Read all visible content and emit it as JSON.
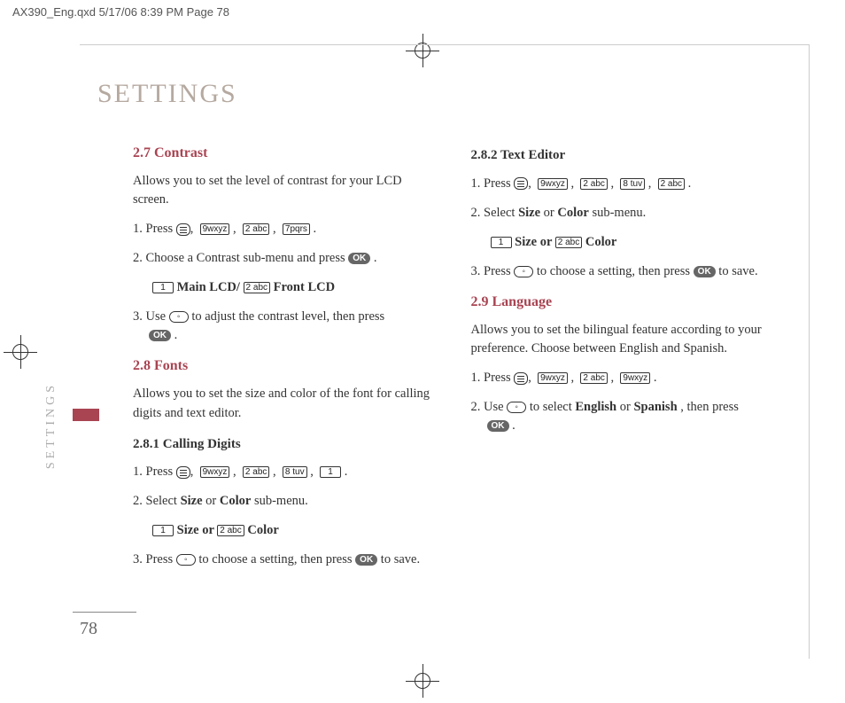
{
  "meta_header": "AX390_Eng.qxd  5/17/06  8:39 PM  Page 78",
  "page_title": "SETTINGS",
  "side_tab": "SETTINGS",
  "page_number": "78",
  "left": {
    "s27_head": "2.7 Contrast",
    "s27_intro": "Allows you to set the level of contrast for your LCD screen.",
    "s27_step1_a": "1. Press ",
    "s27_step1_b": " .",
    "s27_step2_a": "2. Choose a Contrast sub-menu and press ",
    "s27_step2_b": " .",
    "s27_sub_a": " Main LCD/ ",
    "s27_sub_b": " Front LCD",
    "s27_step3_a": "3. Use ",
    "s27_step3_b": " to adjust the contrast level, then press ",
    "s27_step3_c": " .",
    "s28_head": "2.8 Fonts",
    "s28_intro": "Allows you to set the size and color of the font for calling digits and text editor.",
    "s281_head": "2.8.1 Calling Digits",
    "s281_step1_a": "1. Press ",
    "s281_step1_b": " .",
    "s281_step2_a": "2. Select ",
    "s281_step2_size": "Size",
    "s281_step2_or": " or ",
    "s281_step2_color": "Color",
    "s281_step2_b": " sub-menu.",
    "s281_sub_a": " Size or ",
    "s281_sub_b": " Color",
    "s281_step3_a": "3. Press ",
    "s281_step3_b": " to choose a setting, then press ",
    "s281_step3_c": " to save."
  },
  "right": {
    "s282_head": "2.8.2 Text Editor",
    "s282_step1_a": "1. Press ",
    "s282_step1_b": " .",
    "s282_step2_a": "2. Select ",
    "s282_step2_size": "Size",
    "s282_step2_or": " or ",
    "s282_step2_color": "Color",
    "s282_step2_b": " sub-menu.",
    "s282_sub_a": " Size or ",
    "s282_sub_b": " Color",
    "s282_step3_a": "3. Press ",
    "s282_step3_b": " to choose a setting, then press ",
    "s282_step3_c": " to save.",
    "s29_head": "2.9 Language",
    "s29_intro": "Allows you to set the bilingual feature according to your preference. Choose between English and Spanish.",
    "s29_step1_a": "1. Press ",
    "s29_step1_b": " .",
    "s29_step2_a": "2. Use ",
    "s29_step2_b": " to select ",
    "s29_step2_eng": "English",
    "s29_step2_or": " or ",
    "s29_step2_spa": "Spanish",
    "s29_step2_c": ", then press ",
    "s29_step2_d": " ."
  },
  "keys": {
    "menu": "",
    "k9": "9wxyz",
    "k2": "2 abc",
    "k7": "7pqrs",
    "k8": "8 tuv",
    "k1": "1",
    "ok": "OK",
    "nav": ""
  }
}
